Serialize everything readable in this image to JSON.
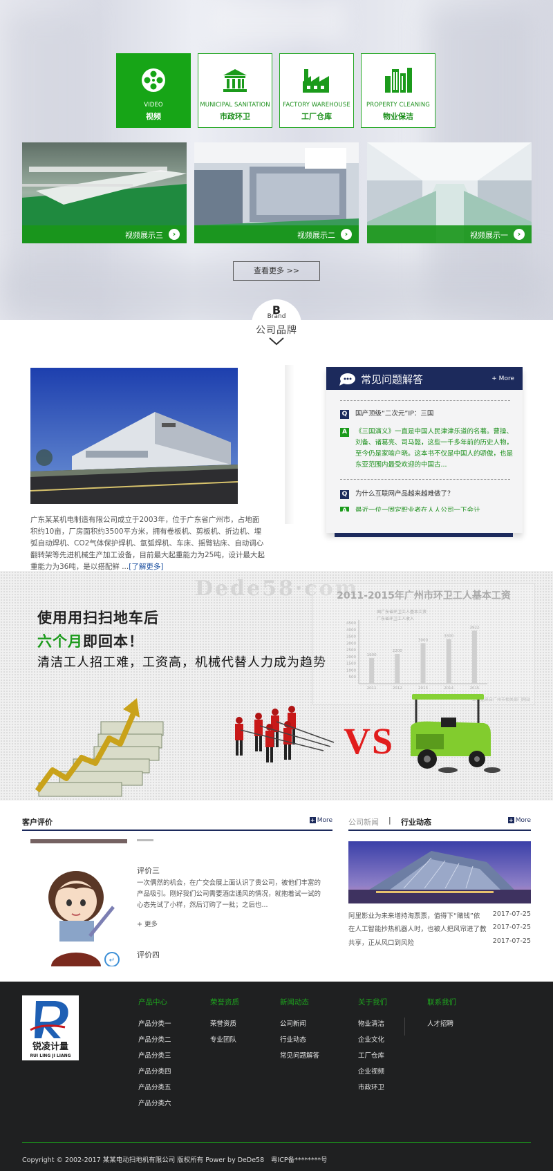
{
  "categories": [
    {
      "en": "VIDEO",
      "cn": "视频",
      "icon": "film-reel-icon",
      "active": true
    },
    {
      "en": "MUNICIPAL SANITATION",
      "cn": "市政环卫",
      "icon": "government-building-icon",
      "active": false
    },
    {
      "en": "FACTORY WAREHOUSE",
      "cn": "工厂仓库",
      "icon": "factory-icon",
      "active": false
    },
    {
      "en": "PROPERTY CLEANING",
      "cn": "物业保洁",
      "icon": "city-buildings-icon",
      "active": false
    }
  ],
  "videos": [
    {
      "caption": "视频展示三"
    },
    {
      "caption": "视频展示二"
    },
    {
      "caption": "视频展示一"
    }
  ],
  "more_button": "查看更多 >>",
  "brand": {
    "logo": "B",
    "en": "Brand",
    "title": "公司品牌"
  },
  "company": {
    "intro": "广东某某机电制造有限公司成立于2003年，位于广东省广州市，占地面积约10亩，厂房面积约3500平方米，拥有卷板机、剪板机、折边机、埋弧自动焊机、CO2气体保护焊机、氩弧焊机、车床、摇臂钻床、自动调心翻转架等先进机械生产加工设备，目前最大起重能力为25吨，设计最大起重能力为36吨，是以搭配鲜 ...",
    "more": "[了解更多]"
  },
  "faq": {
    "title": "常见问题解答",
    "more": "+ More",
    "items": [
      {
        "tag": "Q",
        "text": "国产顶级“二次元”IP：三国"
      },
      {
        "tag": "A",
        "text": "《三国演义》一直是中国人民津津乐道的名著。曹操、刘备、诸葛亮、司马懿，这些一千多年前的历史人物，至今仍是家喻户晓。这本书不仅是中国人的骄傲，也是东亚范围内最受欢迎的中国古..."
      },
      {
        "tag": "Q",
        "text": "为什么互联网产品越来越难做了？"
      },
      {
        "tag": "A",
        "text": "最近一位一固定职业者在人人公司一下会计"
      }
    ]
  },
  "ad": {
    "line1": "使用用扫扫地车后",
    "line2_green": "六个月",
    "line2_rest": "即回本！",
    "line3": "清洁工人招工难，工资高，机械代替人力成为趋势",
    "watermark": "Dede58·com",
    "vs": "VS"
  },
  "chart_data": {
    "type": "bar",
    "title": "2011-2015年广州市环卫工人基本工资",
    "legend": [
      "国广东省环卫工人基本工资",
      "广东省环卫工人收入"
    ],
    "categories": [
      "2011",
      "2012",
      "2013",
      "2014",
      "2015"
    ],
    "values": [
      1900,
      2200,
      3000,
      3300,
      3922
    ],
    "data_labels": [
      "1900",
      "2200",
      "3000",
      "3300",
      "3922"
    ],
    "ylim": [
      0,
      4500
    ],
    "yticks": [
      "4500",
      "4000",
      "3500",
      "3000",
      "2500",
      "2000",
      "1500",
      "1000",
      "500"
    ],
    "footnote": "上数据来自广州市相关部门网站"
  },
  "reviews": {
    "title": "客户评价",
    "more": "More",
    "items": [
      {
        "name": "评价三",
        "text": "一次偶然的机会，在广交会展上面认识了贵公司，被他们丰富的产品吸引。刚好我们公司需要酒店通风的情况，就抱着试一试的心态先试了小样，然后订购了一批；之后也...",
        "more": "+ 更多"
      },
      {
        "name": "评价四"
      }
    ]
  },
  "news": {
    "tab_inactive": "公司新闻",
    "separator": "|",
    "tab_active": "行业动态",
    "more": "More",
    "items": [
      {
        "title": "阿里影业为未来增持淘票票，值得下“赌钱”依",
        "date": "2017-07-25"
      },
      {
        "title": "在人工智能抄热机器人时，也被人把风帘进了教",
        "date": "2017-07-25"
      },
      {
        "title": "共享，正从风口到风险",
        "date": "2017-07-25"
      }
    ]
  },
  "footer": {
    "logo_cn": "锐凌计量",
    "logo_en": "RUI LING JI LIANG",
    "columns": [
      {
        "title": "产品中心",
        "items": [
          "产品分类一",
          "产品分类二",
          "产品分类三",
          "产品分类四",
          "产品分类五",
          "产品分类六"
        ]
      },
      {
        "title": "荣誉资质",
        "items": [
          "荣誉资质",
          "专业团队"
        ]
      },
      {
        "title": "新闻动态",
        "items": [
          "公司新闻",
          "行业动态",
          "常见问题解答"
        ]
      },
      {
        "title": "关于我们",
        "items": [
          "物业清洁",
          "企业文化",
          "工厂仓库",
          "企业视频",
          "市政环卫"
        ]
      },
      {
        "title": "联系我们",
        "items": [
          "人才招聘"
        ]
      }
    ],
    "copyright": "Copyright © 2002-2017 某某电动扫地机有限公司 版权所有 Power by DeDe58",
    "icp": "粤ICP备********号"
  },
  "colors": {
    "brand_green": "#17a517",
    "navy": "#1c2a5c",
    "footer_bg": "#1f2021",
    "vs_red": "#e11d1d"
  }
}
